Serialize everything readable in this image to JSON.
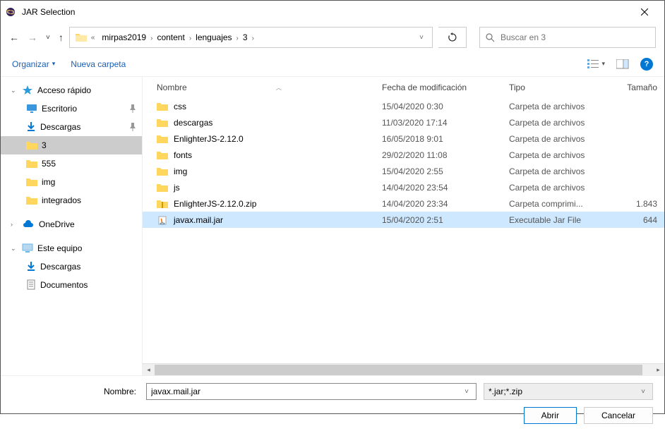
{
  "title": "JAR Selection",
  "breadcrumb": [
    "mirpas2019",
    "content",
    "lenguajes",
    "3"
  ],
  "search": {
    "placeholder": "Buscar en 3"
  },
  "toolbar": {
    "organize": "Organizar",
    "newfolder": "Nueva carpeta"
  },
  "columns": {
    "name": "Nombre",
    "date": "Fecha de modificación",
    "type": "Tipo",
    "size": "Tamaño"
  },
  "sidebar": [
    {
      "kind": "head",
      "icon": "star",
      "label": "Acceso rápido",
      "exp": true
    },
    {
      "kind": "child",
      "icon": "desktop",
      "label": "Escritorio",
      "pin": true
    },
    {
      "kind": "child",
      "icon": "dl",
      "label": "Descargas",
      "pin": true
    },
    {
      "kind": "child",
      "icon": "folder",
      "label": "3",
      "sel": true
    },
    {
      "kind": "child",
      "icon": "folder",
      "label": "555"
    },
    {
      "kind": "child",
      "icon": "folder",
      "label": "img"
    },
    {
      "kind": "child",
      "icon": "folder",
      "label": "integrados"
    },
    {
      "kind": "gap"
    },
    {
      "kind": "head",
      "icon": "cloud",
      "label": "OneDrive",
      "exp": false
    },
    {
      "kind": "gap"
    },
    {
      "kind": "head",
      "icon": "pc",
      "label": "Este equipo",
      "exp": true
    },
    {
      "kind": "child",
      "icon": "dl",
      "label": "Descargas"
    },
    {
      "kind": "child",
      "icon": "doc",
      "label": "Documentos"
    }
  ],
  "files": [
    {
      "icon": "folder",
      "name": "css",
      "date": "15/04/2020 0:30",
      "type": "Carpeta de archivos",
      "size": ""
    },
    {
      "icon": "folder",
      "name": "descargas",
      "date": "11/03/2020 17:14",
      "type": "Carpeta de archivos",
      "size": ""
    },
    {
      "icon": "folder",
      "name": "EnlighterJS-2.12.0",
      "date": "16/05/2018 9:01",
      "type": "Carpeta de archivos",
      "size": ""
    },
    {
      "icon": "folder",
      "name": "fonts",
      "date": "29/02/2020 11:08",
      "type": "Carpeta de archivos",
      "size": ""
    },
    {
      "icon": "folder",
      "name": "img",
      "date": "15/04/2020 2:55",
      "type": "Carpeta de archivos",
      "size": ""
    },
    {
      "icon": "folder",
      "name": "js",
      "date": "14/04/2020 23:54",
      "type": "Carpeta de archivos",
      "size": ""
    },
    {
      "icon": "zip",
      "name": "EnlighterJS-2.12.0.zip",
      "date": "14/04/2020 23:34",
      "type": "Carpeta comprimi...",
      "size": "1.843"
    },
    {
      "icon": "jar",
      "name": "javax.mail.jar",
      "date": "15/04/2020 2:51",
      "type": "Executable Jar File",
      "size": "644",
      "sel": true
    }
  ],
  "filename": {
    "label": "Nombre:",
    "value": "javax.mail.jar"
  },
  "filter": "*.jar;*.zip",
  "buttons": {
    "open": "Abrir",
    "cancel": "Cancelar"
  }
}
